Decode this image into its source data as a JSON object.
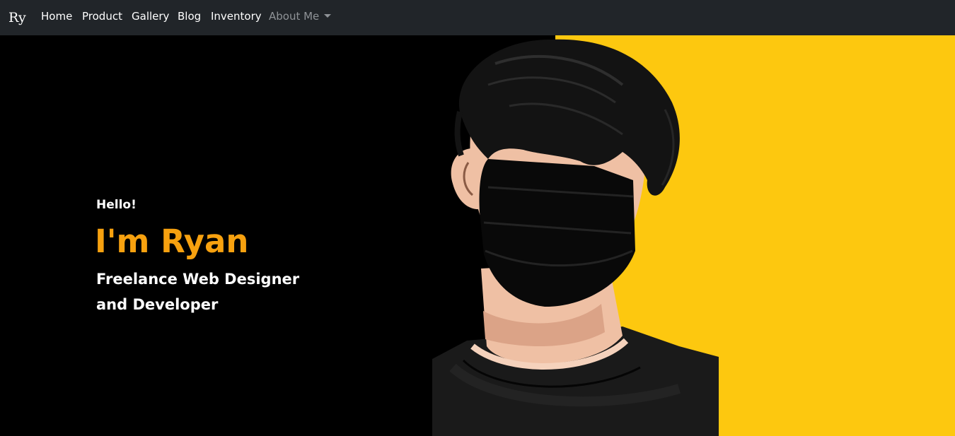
{
  "navbar": {
    "brand": "Ry",
    "items": [
      {
        "label": "Home"
      },
      {
        "label": "Product"
      },
      {
        "label": "Gallery"
      },
      {
        "label": "Blog"
      },
      {
        "label": "Inventory"
      },
      {
        "label": "About Me"
      }
    ]
  },
  "hero": {
    "greeting": "Hello!",
    "headline": "I'm Ryan",
    "tagline": "Freelance Web Designer and Developer"
  },
  "colors": {
    "navbar_bg": "#212529",
    "hero_bg": "#000000",
    "accent": "#f7a10f",
    "panel_yellow": "#fdc80f"
  }
}
